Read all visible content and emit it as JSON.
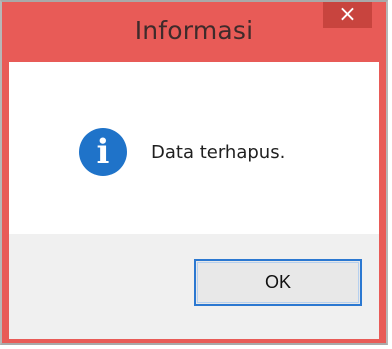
{
  "dialog": {
    "title": "Informasi",
    "close_icon": "close-icon",
    "message": "Data terhapus.",
    "icon": "info-icon",
    "ok_label": "OK"
  },
  "colors": {
    "titlebar": "#e85b57",
    "close_button": "#c8443e",
    "info_icon": "#1f73c9",
    "ok_border": "#2b78d1",
    "footer": "#f0f0f0"
  }
}
